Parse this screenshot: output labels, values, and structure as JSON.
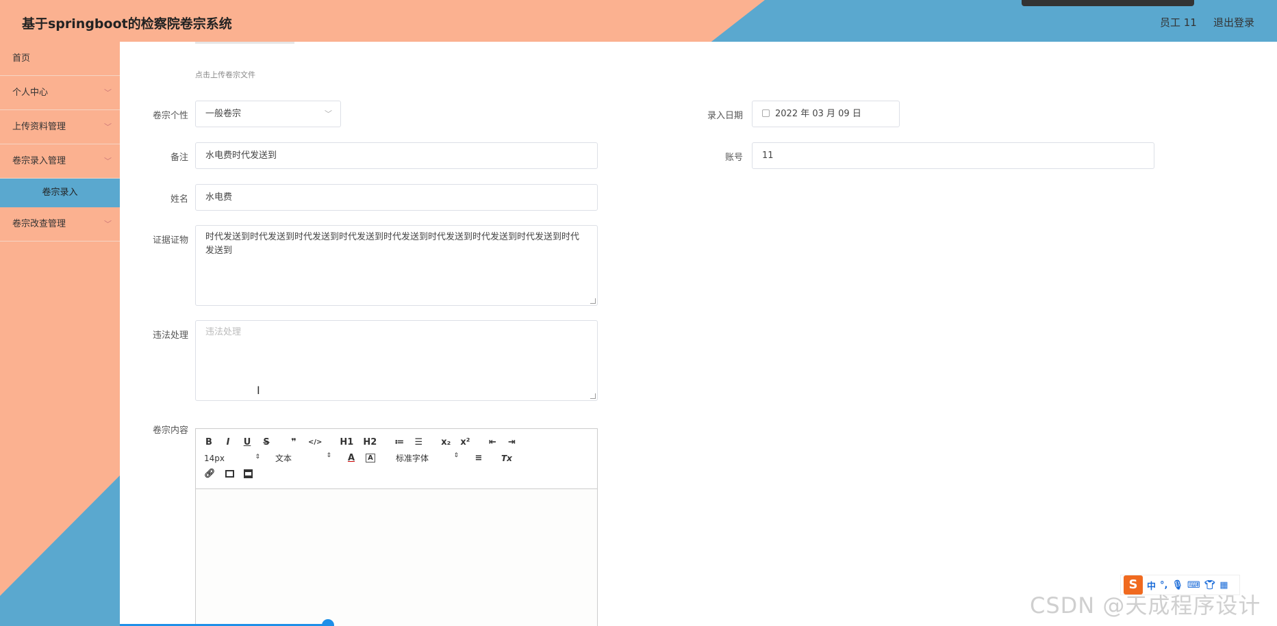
{
  "header": {
    "title": "基于springboot的检察院卷宗系统",
    "user": "员工 11",
    "logout": "退出登录"
  },
  "sidebar": {
    "items": [
      {
        "label": "首页",
        "has_chevron": false
      },
      {
        "label": "个人中心",
        "has_chevron": true
      },
      {
        "label": "上传资料管理",
        "has_chevron": true
      },
      {
        "label": "卷宗录入管理",
        "has_chevron": true
      },
      {
        "label": "卷宗改查管理",
        "has_chevron": true
      }
    ],
    "active_sub": "卷宗录入"
  },
  "form": {
    "upload_hint": "点击上传卷宗文件",
    "personality": {
      "label": "卷宗个性",
      "value": "一般卷宗"
    },
    "date": {
      "label": "录入日期",
      "value": "2022 年 03 月 09 日"
    },
    "remark": {
      "label": "备注",
      "value": "水电费时代发送到"
    },
    "account": {
      "label": "账号",
      "value": "11"
    },
    "name": {
      "label": "姓名",
      "value": "水电费"
    },
    "evidence": {
      "label": "证据证物",
      "value": "时代发送到时代发送到时代发送到时代发送到时代发送到时代发送到时代发送到时代发送到时代发送到"
    },
    "violation": {
      "label": "违法处理",
      "placeholder": "违法处理"
    },
    "content": {
      "label": "卷宗内容"
    }
  },
  "editor": {
    "row1": [
      "B",
      "I",
      "U",
      "S",
      "❞",
      "</>",
      "H1",
      "H2",
      "≔",
      "☰",
      "x₂",
      "x²",
      "⇤",
      "⇥"
    ],
    "font_size": "14px",
    "block_type": "文本",
    "font_color": "A",
    "bg_color": "A",
    "font_family": "标准字体",
    "align": "≡",
    "clear": "Tx",
    "row3": [
      "link-icon",
      "image-icon",
      "video-icon"
    ]
  },
  "ime": {
    "logo": "S",
    "lang": "中"
  },
  "watermark": "CSDN @天成程序设计",
  "colors": {
    "peach": "#fbb190",
    "blue": "#5aa8cf"
  }
}
